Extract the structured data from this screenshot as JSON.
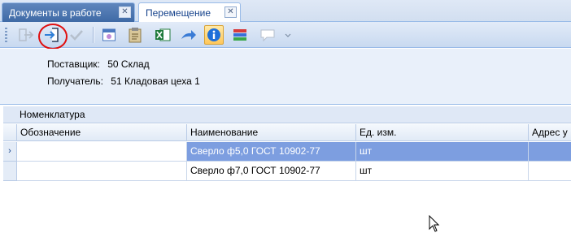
{
  "tabs": [
    {
      "label": "Документы в работе",
      "active": false
    },
    {
      "label": "Перемещение",
      "active": true
    }
  ],
  "tab_close_glyph": "✕",
  "toolbar": {
    "buttons": [
      {
        "icon": "arrow-out-icon",
        "enabled": false
      },
      {
        "icon": "arrow-in-document-icon",
        "enabled": true,
        "annotated": true
      },
      {
        "icon": "checkmark-icon",
        "enabled": false
      },
      {
        "icon": "calendar-window-icon",
        "enabled": true
      },
      {
        "icon": "clipboard-icon",
        "enabled": true
      },
      {
        "icon": "excel-icon",
        "enabled": true
      },
      {
        "icon": "forward-arrow-icon",
        "enabled": true
      },
      {
        "icon": "info-icon",
        "enabled": true,
        "highlighted": true
      },
      {
        "icon": "color-layers-icon",
        "enabled": true
      },
      {
        "icon": "comment-dropdown-icon",
        "enabled": false
      }
    ],
    "colors": {
      "excel": "#1f7a3a",
      "info": "#1e6fd9",
      "arrow": "#3a7bd5"
    }
  },
  "info": {
    "supplier_label": "Поставщик:",
    "supplier_value": "50 Склад",
    "receiver_label": "Получатель:",
    "receiver_value": "51 Кладовая цеха 1"
  },
  "grid": {
    "group_header": "Номенклатура",
    "columns": [
      "Обозначение",
      "Наименование",
      "Ед. изм.",
      "Адрес у"
    ],
    "rows": [
      {
        "indicator": "›",
        "designation": "",
        "name": "Сверло ф5,0 ГОСТ 10902-77",
        "unit": "шт",
        "address": "",
        "selected": true
      },
      {
        "indicator": "",
        "designation": "",
        "name": "Сверло ф7,0 ГОСТ 10902-77",
        "unit": "шт",
        "address": "",
        "selected": false
      }
    ],
    "selection_color": "#7d9ee0"
  }
}
